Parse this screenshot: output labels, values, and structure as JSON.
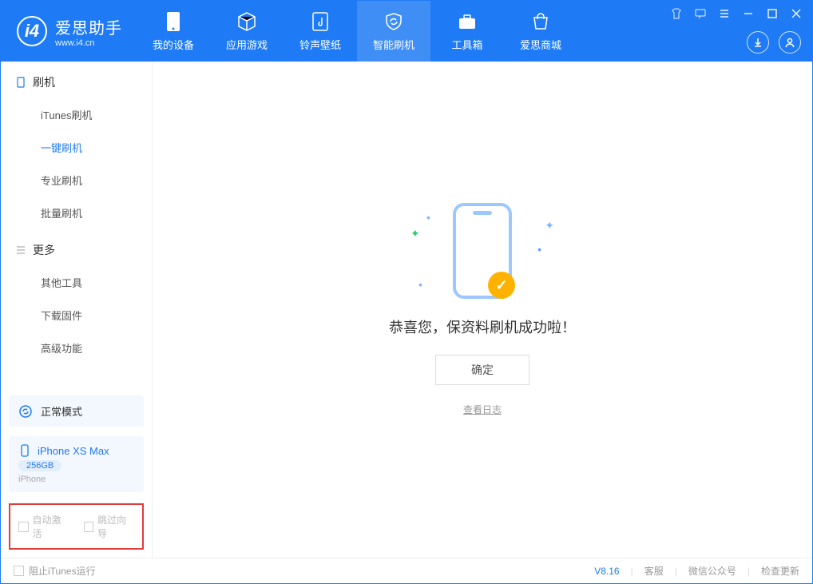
{
  "app": {
    "name_cn": "爱思助手",
    "name_en": "www.i4.cn"
  },
  "nav": {
    "tabs": [
      {
        "label": "我的设备"
      },
      {
        "label": "应用游戏"
      },
      {
        "label": "铃声壁纸"
      },
      {
        "label": "智能刷机"
      },
      {
        "label": "工具箱"
      },
      {
        "label": "爱思商城"
      }
    ]
  },
  "sidebar": {
    "group1": {
      "title": "刷机",
      "items": [
        "iTunes刷机",
        "一键刷机",
        "专业刷机",
        "批量刷机"
      ]
    },
    "group2": {
      "title": "更多",
      "items": [
        "其他工具",
        "下载固件",
        "高级功能"
      ]
    },
    "mode": {
      "label": "正常模式"
    },
    "device": {
      "name": "iPhone XS Max",
      "storage": "256GB",
      "type": "iPhone"
    },
    "checkboxes": {
      "auto_activate": "自动激活",
      "skip_guide": "跳过向导"
    }
  },
  "main": {
    "success_msg": "恭喜您，保资料刷机成功啦！",
    "ok_button": "确定",
    "view_log": "查看日志"
  },
  "status": {
    "block_itunes": "阻止iTunes运行",
    "version": "V8.16",
    "links": [
      "客服",
      "微信公众号",
      "检查更新"
    ]
  }
}
